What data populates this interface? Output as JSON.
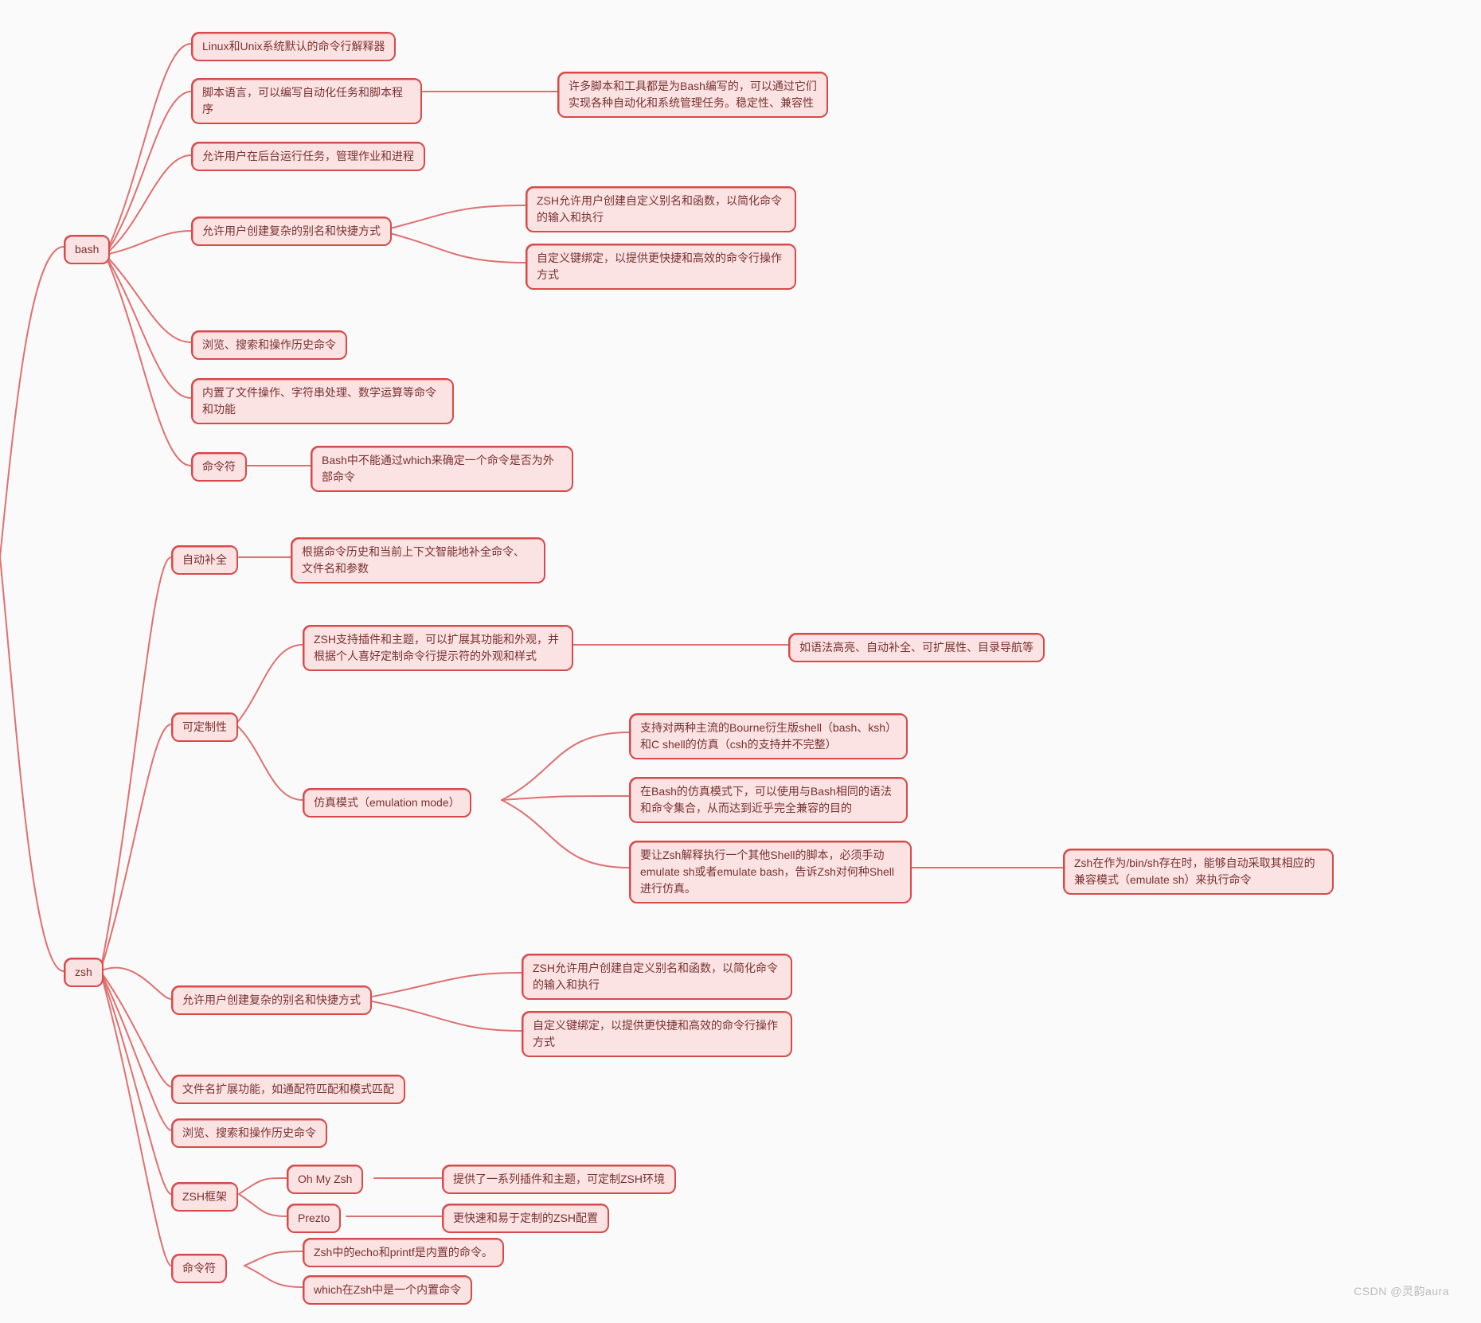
{
  "diagram": {
    "type": "mindmap",
    "roots": [
      "bash",
      "zsh"
    ],
    "bash": {
      "label": "bash",
      "c1": "Linux和Unix系统默认的命令行解释器",
      "c2": "脚本语言，可以编写自动化任务和脚本程序",
      "c2a": "许多脚本和工具都是为Bash编写的，可以通过它们实现各种自动化和系统管理任务。稳定性、兼容性",
      "c3": "允许用户在后台运行任务，管理作业和进程",
      "c4": "允许用户创建复杂的别名和快捷方式",
      "c4a": "ZSH允许用户创建自定义别名和函数，以简化命令的输入和执行",
      "c4b": "自定义键绑定，以提供更快捷和高效的命令行操作方式",
      "c5": "浏览、搜索和操作历史命令",
      "c6": "内置了文件操作、字符串处理、数学运算等命令和功能",
      "c7": "命令符",
      "c7a": "Bash中不能通过which来确定一个命令是否为外部命令"
    },
    "zsh": {
      "label": "zsh",
      "c1": "自动补全",
      "c1a": "根据命令历史和当前上下文智能地补全命令、文件名和参数",
      "c2": "可定制性",
      "c2a": "ZSH支持插件和主题，可以扩展其功能和外观，并根据个人喜好定制命令行提示符的外观和样式",
      "c2a1": "如语法高亮、自动补全、可扩展性、目录导航等",
      "c2b": "仿真模式（emulation mode）",
      "c2b1": "支持对两种主流的Bourne衍生版shell（bash、ksh）和C shell的仿真（csh的支持并不完整）",
      "c2b2": "在Bash的仿真模式下，可以使用与Bash相同的语法和命令集合，从而达到近乎完全兼容的目的",
      "c2b3": "要让Zsh解释执行一个其他Shell的脚本，必须手动emulate sh或者emulate bash，告诉Zsh对何种Shell进行仿真。",
      "c2b3a": "Zsh在作为/bin/sh存在时，能够自动采取其相应的兼容模式（emulate sh）来执行命令",
      "c3": "允许用户创建复杂的别名和快捷方式",
      "c3a": "ZSH允许用户创建自定义别名和函数，以简化命令的输入和执行",
      "c3b": "自定义键绑定，以提供更快捷和高效的命令行操作方式",
      "c4": "文件名扩展功能，如通配符匹配和模式匹配",
      "c5": "浏览、搜索和操作历史命令",
      "c6": "ZSH框架",
      "c6a": "Oh My Zsh",
      "c6a1": "提供了一系列插件和主题，可定制ZSH环境",
      "c6b": "Prezto",
      "c6b1": "更快速和易于定制的ZSH配置",
      "c7": "命令符",
      "c7a": "Zsh中的echo和printf是内置的命令。",
      "c7b": "which在Zsh中是一个内置命令"
    }
  },
  "watermark": "CSDN @灵韵aura"
}
